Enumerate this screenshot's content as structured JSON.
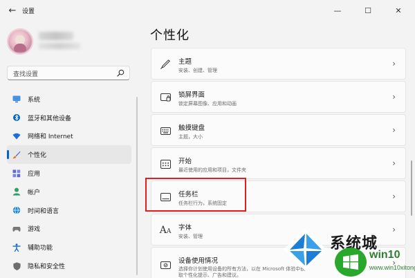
{
  "window": {
    "title": "设置",
    "back_glyph": "←",
    "controls": {
      "minimize": "—",
      "maximize": "☐",
      "close": "✕"
    }
  },
  "profile": {
    "avatar": "user-avatar"
  },
  "search": {
    "placeholder": "查找设置"
  },
  "sidebar": {
    "items": [
      {
        "label": "系统",
        "icon": "monitor-icon",
        "color": "#3a7bd5"
      },
      {
        "label": "蓝牙和其他设备",
        "icon": "bluetooth-icon",
        "color": "#0067c0"
      },
      {
        "label": "网络和 Internet",
        "icon": "wifi-icon",
        "color": "#1e6fd9"
      },
      {
        "label": "个性化",
        "icon": "brush-icon",
        "color": "#e07a2e",
        "active": true
      },
      {
        "label": "应用",
        "icon": "apps-icon",
        "color": "#5b6bcf"
      },
      {
        "label": "帐户",
        "icon": "account-icon",
        "color": "#2aa26a"
      },
      {
        "label": "时间和语言",
        "icon": "globe-clock-icon",
        "color": "#1a8ad4"
      },
      {
        "label": "游戏",
        "icon": "gamepad-icon",
        "color": "#777777"
      },
      {
        "label": "辅助功能",
        "icon": "accessibility-icon",
        "color": "#1f6fcf"
      },
      {
        "label": "隐私和安全性",
        "icon": "shield-icon",
        "color": "#6d6d6d"
      }
    ]
  },
  "main": {
    "title": "个性化",
    "cards": [
      {
        "title": "主题",
        "subtitle": "安装、创建、管理",
        "icon": "pen-icon"
      },
      {
        "title": "锁屏界面",
        "subtitle": "锁定屏幕图像、应用和动画",
        "icon": "lock-screen-icon"
      },
      {
        "title": "触摸键盘",
        "subtitle": "主题，大小",
        "icon": "keyboard-icon"
      },
      {
        "title": "开始",
        "subtitle": "最近使用的应用和项目，文件夹",
        "icon": "start-icon"
      },
      {
        "title": "任务栏",
        "subtitle": "任务栏行为，系统固定",
        "icon": "taskbar-icon"
      },
      {
        "title": "字体",
        "subtitle": "安装、管理",
        "icon": "font-icon"
      },
      {
        "title": "设备使用情况",
        "subtitle": "选择你计划使用设备的所有方法，以在 Microsoft 体验中获取个性化提示、广告和建议。",
        "icon": "device-usage-icon"
      }
    ],
    "highlighted_card": "任务栏"
  },
  "watermark": {
    "text_top": "系统城",
    "brand": "win10",
    "url": "www.win10xitong.com",
    "color": "#2aa82e"
  }
}
